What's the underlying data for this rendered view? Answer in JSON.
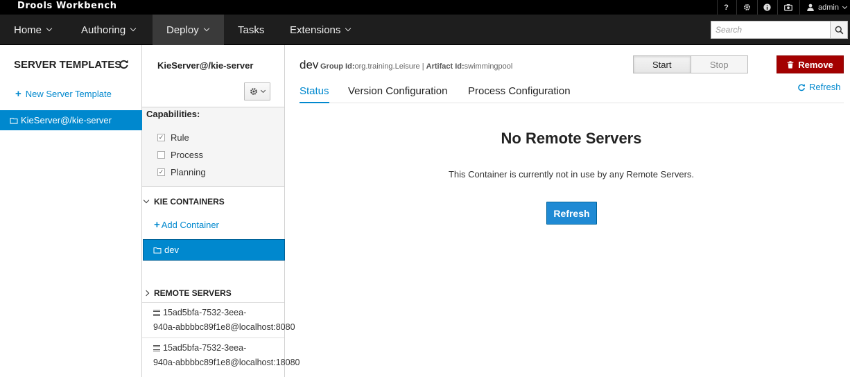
{
  "topbar": {
    "brand": "Drools Workbench",
    "help_icon": "?",
    "user": "admin"
  },
  "nav": {
    "items": [
      {
        "label": "Home",
        "has_caret": true
      },
      {
        "label": "Authoring",
        "has_caret": true
      },
      {
        "label": "Deploy",
        "has_caret": true,
        "active": true
      },
      {
        "label": "Tasks",
        "has_caret": false
      },
      {
        "label": "Extensions",
        "has_caret": true
      }
    ],
    "search_placeholder": "Search"
  },
  "server_templates": {
    "title": "SERVER TEMPLATES",
    "new_template": "New Server Template",
    "items": [
      {
        "label": "KieServer@/kie-server",
        "selected": true
      }
    ]
  },
  "server": {
    "title": "KieServer@/kie-server",
    "capabilities_title": "Capabilities:",
    "capabilities": [
      {
        "label": "Rule",
        "checked": true
      },
      {
        "label": "Process",
        "checked": false
      },
      {
        "label": "Planning",
        "checked": true
      }
    ],
    "containers_title": "KIE CONTAINERS",
    "add_container": "Add Container",
    "containers": [
      {
        "label": "dev",
        "selected": true
      }
    ],
    "remote_title": "REMOTE SERVERS",
    "remote_servers": [
      {
        "line1": "15ad5bfa-7532-3eea-",
        "line2": "940a-abbbbc89f1e8@localhost:8080"
      },
      {
        "line1": "15ad5bfa-7532-3eea-",
        "line2": "940a-abbbbc89f1e8@localhost:18080"
      }
    ]
  },
  "container": {
    "name": "dev",
    "group_id_label": "Group Id:",
    "group_id": "org.training.Leisure",
    "separator": "|",
    "artifact_id_label": "Artifact Id:",
    "artifact_id": "swimmingpool",
    "start_label": "Start",
    "stop_label": "Stop",
    "remove_label": "Remove",
    "tabs": [
      {
        "label": "Status",
        "active": true
      },
      {
        "label": "Version Configuration",
        "active": false
      },
      {
        "label": "Process Configuration",
        "active": false
      }
    ],
    "refresh_link": "Refresh",
    "empty_title": "No Remote Servers",
    "empty_text": "This Container is currently not in use by any Remote Servers.",
    "refresh_button": "Refresh"
  },
  "colors": {
    "accent": "#0088ce",
    "danger": "#a30000",
    "topbar": "#000000",
    "navbar": "#1e1e1e"
  }
}
